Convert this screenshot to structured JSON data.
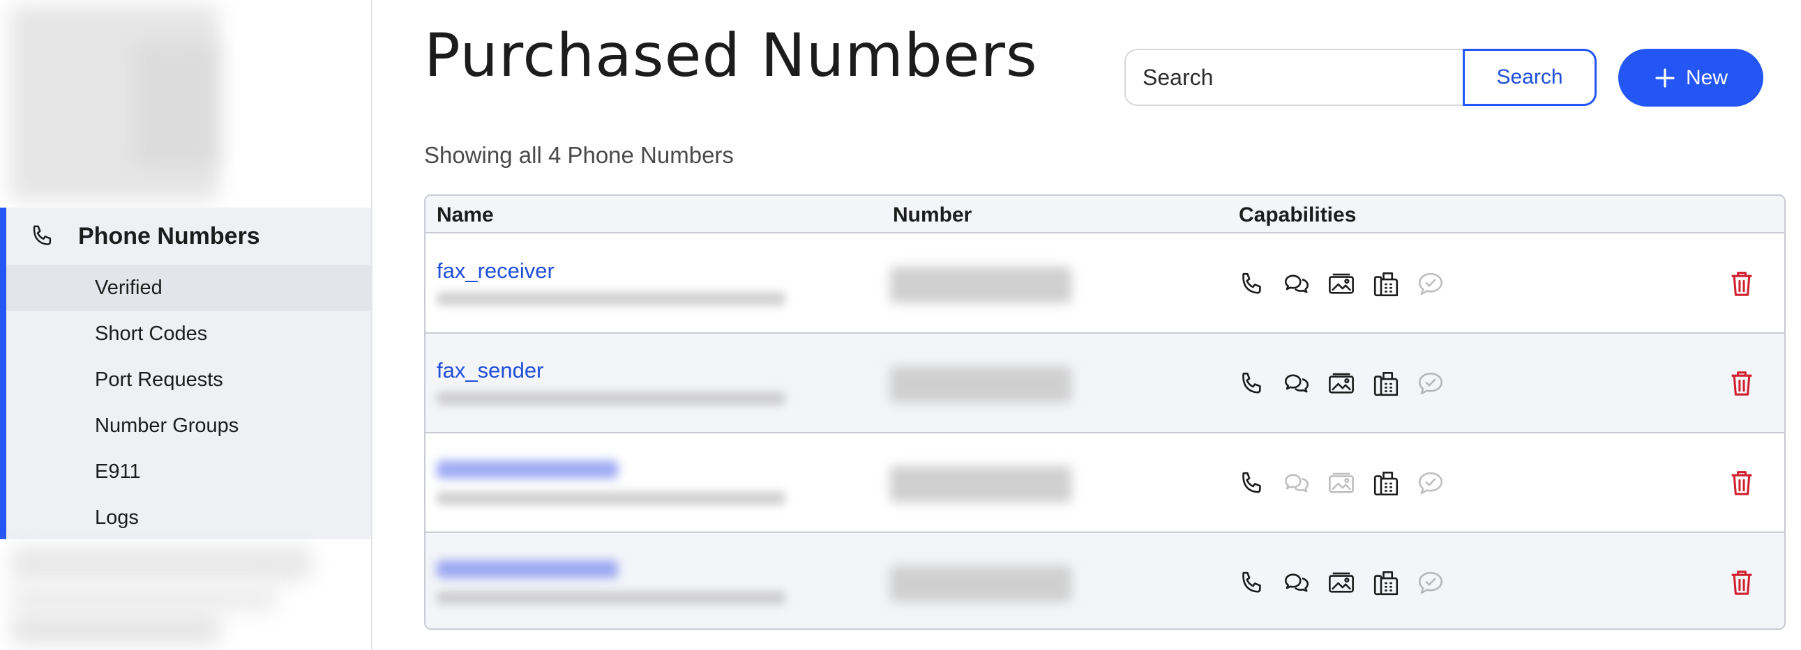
{
  "sidebar": {
    "section_label": "Phone Numbers",
    "items": [
      {
        "label": "Verified",
        "active": true
      },
      {
        "label": "Short Codes",
        "active": false
      },
      {
        "label": "Port Requests",
        "active": false
      },
      {
        "label": "Number Groups",
        "active": false
      },
      {
        "label": "E911",
        "active": false
      },
      {
        "label": "Logs",
        "active": false
      }
    ],
    "accent_color": "#2356f5"
  },
  "header": {
    "title": "Purchased Numbers",
    "search_placeholder": "Search",
    "search_button": "Search",
    "new_button": "New"
  },
  "summary": "Showing all 4 Phone Numbers",
  "table": {
    "columns": [
      "Name",
      "Number",
      "Capabilities"
    ],
    "rows": [
      {
        "name": "fax_receiver",
        "capabilities": {
          "voice": true,
          "sms": true,
          "mms": true,
          "fax": true,
          "verified": false
        }
      },
      {
        "name": "fax_sender",
        "capabilities": {
          "voice": true,
          "sms": true,
          "mms": true,
          "fax": true,
          "verified": false
        }
      },
      {
        "name": "",
        "capabilities": {
          "voice": true,
          "sms": false,
          "mms": false,
          "fax": true,
          "verified": false
        }
      },
      {
        "name": "",
        "capabilities": {
          "voice": true,
          "sms": true,
          "mms": true,
          "fax": true,
          "verified": false
        }
      }
    ]
  },
  "colors": {
    "link": "#1f4fd8",
    "primary": "#2356f5",
    "delete": "#d0202e"
  }
}
